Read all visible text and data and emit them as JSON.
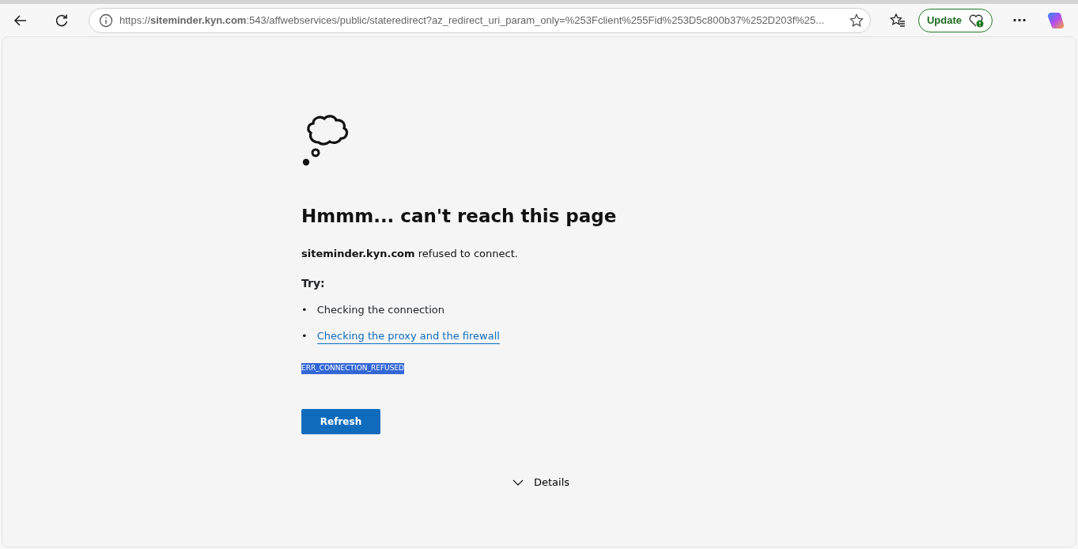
{
  "toolbar": {
    "address": "https://**siteminder.kyn.com**:543/affwebservices/public/stateredirect?az_redirect_uri_param_only=%253Fclient%255Fid%253D5c800b37%252D203f%25...",
    "update_button": "Update",
    "more_button": "···"
  },
  "error_page": {
    "heading": "Hmmm... can't reach this page",
    "message": "**siteminder.kyn.com** refused to connect.",
    "try_label": "Try:",
    "suggestions": [
      {
        "bullet": "•",
        "text": "Checking the connection",
        "kind": "text"
      },
      {
        "bullet": "•",
        "text": "Checking the proxy and the firewall",
        "kind": "link"
      }
    ],
    "error_code": {
      "text": "ERR_CONNECTION_REFUSED",
      "selected": true
    },
    "refresh_button": "Refresh",
    "details": {
      "label": "Details",
      "expanded": false
    }
  }
}
